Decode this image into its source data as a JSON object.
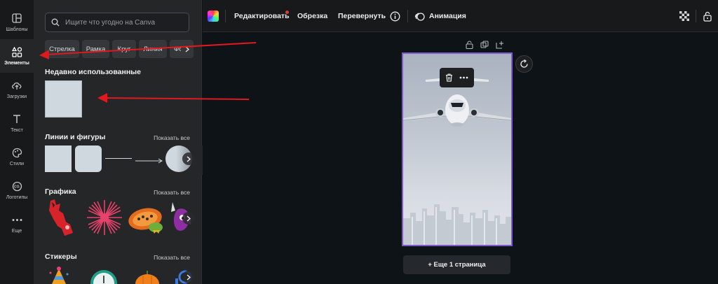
{
  "rail": [
    {
      "label": "Шаблоны",
      "icon": "templates-icon",
      "active": false
    },
    {
      "label": "Элементы",
      "icon": "elements-icon",
      "active": true
    },
    {
      "label": "Загрузки",
      "icon": "upload-cloud-icon",
      "active": false
    },
    {
      "label": "Текст",
      "icon": "text-icon",
      "active": false
    },
    {
      "label": "Стили",
      "icon": "palette-icon",
      "active": false
    },
    {
      "label": "Логотипы",
      "icon": "logo-icon",
      "active": false
    },
    {
      "label": "Еще",
      "icon": "more-dots-icon",
      "active": false
    }
  ],
  "search": {
    "placeholder": "Ищите что угодно на Canva"
  },
  "chips": [
    "Стрелка",
    "Рамка",
    "Круг",
    "Линия",
    "Фон"
  ],
  "sections": {
    "recent": "Недавно использованные",
    "lines_shapes": "Линии и фигуры",
    "graphics": "Графика",
    "stickers": "Стикеры",
    "show_all": "Показать все"
  },
  "toolbar": {
    "edit": "Редактировать",
    "crop": "Обрезка",
    "flip": "Перевернуть",
    "animate": "Анимация"
  },
  "canvas": {
    "add_page": "+ Еще 1 страница"
  },
  "colors": {
    "accent_purple": "#7d5cc9",
    "annotation_red": "#e0191e",
    "notification_red": "#e5343a"
  }
}
